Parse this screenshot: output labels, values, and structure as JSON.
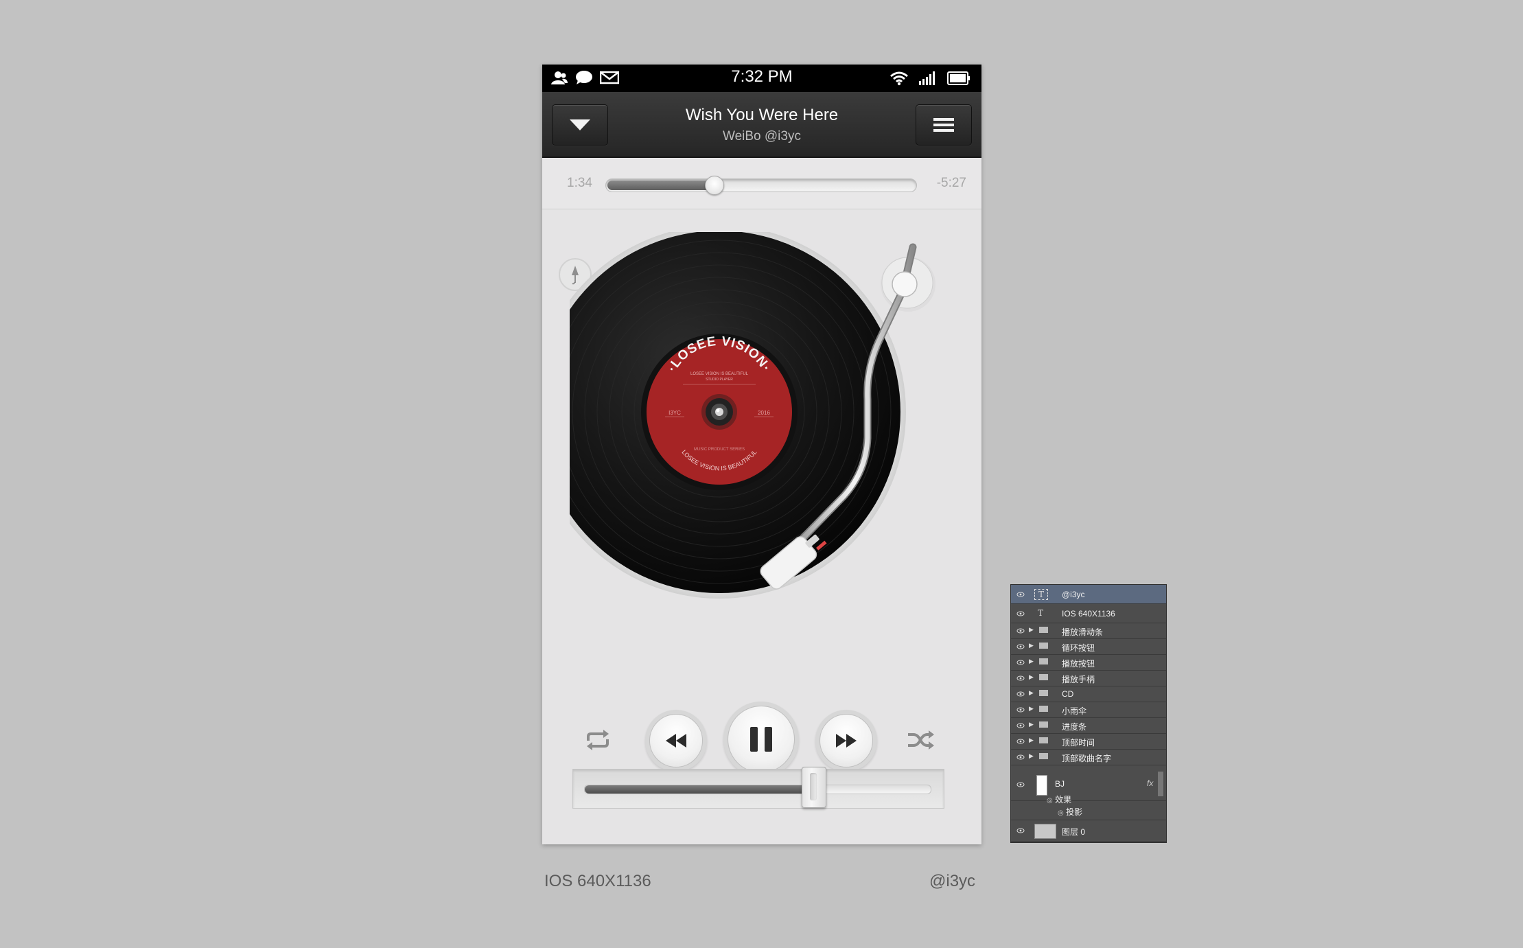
{
  "status_bar": {
    "time": "7:32 PM",
    "left_icons": [
      "contact-icon",
      "chat-bubble-icon",
      "mail-icon"
    ],
    "right_icons": [
      "wifi-icon",
      "signal-icon",
      "battery-icon"
    ]
  },
  "nav": {
    "title": "Wish You Were Here",
    "subtitle": "WeiBo @i3yc",
    "left_button_icon": "chevron-down-icon",
    "right_button_icon": "menu-icon"
  },
  "progress": {
    "elapsed": "1:34",
    "remaining": "-5:27",
    "fraction": 0.35
  },
  "record": {
    "label_top": "·LOSEE VISION·",
    "label_sub1": "LOSEE VISION IS BEAUTIFUL",
    "label_sub2": "STUDIO PLAYER",
    "label_left": "I3YC",
    "label_right": "2016",
    "label_sub3": "MUSIC PRODUCT SERIES",
    "label_bottom": "LOSEE VISION IS BEAUTIFUL",
    "label_color": "#a62425"
  },
  "controls": {
    "repeat_icon": "repeat-icon",
    "rewind_icon": "rewind-icon",
    "pause_icon": "pause-icon",
    "forward_icon": "fast-forward-icon",
    "shuffle_icon": "shuffle-icon"
  },
  "volume": {
    "fraction": 0.66
  },
  "captions": {
    "left": "IOS 640X1136",
    "right": "@i3yc"
  },
  "layers_panel": {
    "rows": [
      {
        "type": "text",
        "name": "@i3yc",
        "selected": true
      },
      {
        "type": "text",
        "name": "IOS 640X1136"
      },
      {
        "type": "folder",
        "name": "播放滑动条"
      },
      {
        "type": "folder",
        "name": "循环按钮"
      },
      {
        "type": "folder",
        "name": "播放按钮"
      },
      {
        "type": "folder",
        "name": "播放手柄"
      },
      {
        "type": "folder",
        "name": "CD"
      },
      {
        "type": "folder",
        "name": "小雨伞"
      },
      {
        "type": "folder",
        "name": "进度条"
      },
      {
        "type": "folder",
        "name": "顶部时间"
      },
      {
        "type": "folder",
        "name": "顶部歌曲名字"
      }
    ],
    "bj": {
      "name": "BJ",
      "fx": "fx",
      "effects": "效果",
      "shadow": "投影"
    },
    "base": {
      "name": "图层 0"
    }
  }
}
